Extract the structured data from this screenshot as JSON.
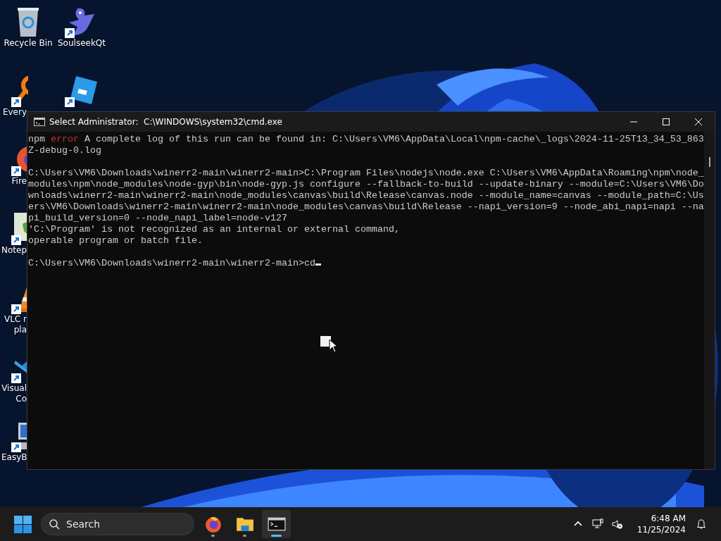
{
  "desktop_icons": [
    {
      "kind": "recycle",
      "label_lines": [
        "Recycle Bin"
      ],
      "covered": false,
      "shortcut": false
    },
    {
      "kind": "magnifier",
      "label_lines": [
        "Every"
      ],
      "covered": true,
      "shortcut": true
    },
    {
      "kind": "fox",
      "label_lines": [
        "Fire"
      ],
      "covered": true,
      "shortcut": true
    },
    {
      "kind": "notepad",
      "label_lines": [
        "Notep"
      ],
      "covered": true,
      "shortcut": true
    },
    {
      "kind": "cone",
      "label_lines": [
        "VLC r",
        "pla"
      ],
      "covered": true,
      "shortcut": true
    },
    {
      "kind": "ribbon",
      "label_lines": [
        "Visual",
        "Co"
      ],
      "covered": true,
      "shortcut": true
    },
    {
      "kind": "computer",
      "label_lines": [
        "EasyB"
      ],
      "covered": true,
      "shortcut": true
    },
    {
      "kind": "bird",
      "label_lines": [
        "SoulseekQt"
      ],
      "covered": false,
      "shortcut": true
    },
    {
      "kind": "tilted",
      "shortcut": true
    }
  ],
  "window": {
    "title": "Select Administrator:  C:\\WINDOWS\\system32\\cmd.exe",
    "blocks": [
      {
        "lines": [
          {
            "segments": [
              {
                "text": "npm "
              },
              {
                "text": "error",
                "kind": "error"
              },
              {
                "text": " A complete log of this run can be found in: C:\\Users\\VM6\\AppData\\Local\\npm-cache\\_logs\\2024-11-25T13_34_53_863"
              }
            ]
          },
          {
            "segments": [
              {
                "text": "Z-debug-0.log"
              }
            ]
          }
        ]
      },
      {
        "lines": [
          {
            "segments": [
              {
                "text": "C:\\Users\\VM6\\Downloads\\winerr2-main\\winerr2-main>C:\\Program Files\\nodejs\\node.exe C:\\Users\\VM6\\AppData\\Roaming\\npm\\node_"
              }
            ]
          },
          {
            "segments": [
              {
                "text": "modules\\npm\\node_modules\\node-gyp\\bin\\node-gyp.js configure --fallback-to-build --update-binary --module=C:\\Users\\VM6\\Do"
              }
            ]
          },
          {
            "segments": [
              {
                "text": "wnloads\\winerr2-main\\winerr2-main\\node_modules\\canvas\\build\\Release\\canvas.node --module_name=canvas --module_path=C:\\Us"
              }
            ]
          },
          {
            "segments": [
              {
                "text": "ers\\VM6\\Downloads\\winerr2-main\\winerr2-main\\node_modules\\canvas\\build\\Release --napi_version=9 --node_abi_napi=napi --na"
              }
            ]
          },
          {
            "segments": [
              {
                "text": "pi_build_version=0 --node_napi_label=node-v127"
              }
            ]
          },
          {
            "segments": [
              {
                "text": "'C:\\Program' is not recognized as an internal or external command,"
              }
            ]
          },
          {
            "segments": [
              {
                "text": "operable program or batch file."
              }
            ]
          }
        ]
      },
      {
        "lines": [
          {
            "segments": [
              {
                "text": "C:\\Users\\VM6\\Downloads\\winerr2-main\\winerr2-main>cd"
              }
            ]
          }
        ]
      }
    ],
    "cursor": true
  },
  "taskbar": {
    "search": {
      "placeholder": "Search"
    },
    "apps": [
      {
        "kind": "firefox",
        "running": true,
        "active": false
      },
      {
        "kind": "folder",
        "running": true,
        "active": false
      },
      {
        "kind": "terminal",
        "running": true,
        "active": true
      }
    ],
    "time": "6:48 AM",
    "date": "11/25/2024"
  }
}
